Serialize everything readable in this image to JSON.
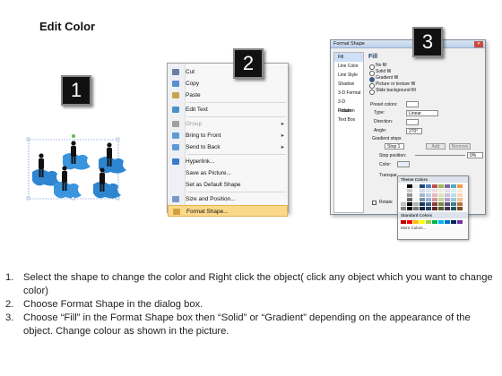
{
  "title": "Edit Color",
  "badges": [
    "1",
    "2",
    "3"
  ],
  "context_menu": {
    "items": [
      {
        "label": "Cut",
        "icon": "scissors-icon",
        "disabled": false,
        "submenu": false
      },
      {
        "label": "Copy",
        "icon": "copy-icon",
        "disabled": false,
        "submenu": false
      },
      {
        "label": "Paste",
        "icon": "paste-icon",
        "disabled": false,
        "submenu": false
      },
      {
        "label": "Edit Text",
        "icon": "edit-text-icon",
        "disabled": false,
        "submenu": false
      },
      {
        "label": "Group",
        "icon": "group-icon",
        "disabled": true,
        "submenu": true
      },
      {
        "label": "Bring to Front",
        "icon": "bring-front-icon",
        "disabled": false,
        "submenu": true
      },
      {
        "label": "Send to Back",
        "icon": "send-back-icon",
        "disabled": false,
        "submenu": true
      },
      {
        "label": "Hyperlink...",
        "icon": "hyperlink-icon",
        "disabled": false,
        "submenu": false
      },
      {
        "label": "Save as Picture...",
        "icon": "",
        "disabled": false,
        "submenu": false
      },
      {
        "label": "Set as Default Shape",
        "icon": "",
        "disabled": false,
        "submenu": false
      },
      {
        "label": "Size and Position...",
        "icon": "size-icon",
        "disabled": false,
        "submenu": false
      },
      {
        "label": "Format Shape...",
        "icon": "format-shape-icon",
        "disabled": false,
        "submenu": false
      }
    ],
    "highlighted": "Format Shape..."
  },
  "format_dialog": {
    "title": "Format Shape",
    "nav": [
      "Fill",
      "Line Color",
      "Line Style",
      "Shadow",
      "3-D Format",
      "3-D Rotation",
      "Picture",
      "Text Box"
    ],
    "heading": "Fill",
    "fill_options": [
      "No fill",
      "Solid fill",
      "Gradient fill",
      "Picture or texture fill",
      "Slide background fill"
    ],
    "selected_fill": "Gradient fill",
    "preset_colors_label": "Preset colors:",
    "type_label": "Type:",
    "type_value": "Linear",
    "direction_label": "Direction:",
    "angle_label": "Angle:",
    "angle_value": "270°",
    "gradient_stops_label": "Gradient stops",
    "stop_value": "Stop 1",
    "add_label": "Add",
    "remove_label": "Remove",
    "stop_position_label": "Stop position:",
    "stop_position_value": "0%",
    "color_label": "Color:",
    "transparency_label": "Transpar",
    "rotate_label": "Rotate"
  },
  "palette": {
    "theme_label": "Theme Colors",
    "standard_label": "Standard Colors",
    "more_label": "More Colors...",
    "theme_top": [
      "#ffffff",
      "#000000",
      "#eeece1",
      "#1f497d",
      "#4f81bd",
      "#c0504d",
      "#9bbb59",
      "#8064a2",
      "#4bacc6",
      "#f79646"
    ],
    "standard": [
      "#c00000",
      "#ff0000",
      "#ffc000",
      "#ffff00",
      "#92d050",
      "#00b050",
      "#00b0f0",
      "#0070c0",
      "#002060",
      "#7030a0"
    ]
  },
  "steps": [
    {
      "n": "1.",
      "text": "Select the shape to change the color and Right click the object( click any object which you want to change color)"
    },
    {
      "n": "2.",
      "text": "Choose Format Shape in the dialog box."
    },
    {
      "n": "3.",
      "text": "Choose “Fill” in the Format Shape box then “Solid” or “Gradient” depending on the appearance of the object. Change colour as shown in the picture."
    }
  ]
}
